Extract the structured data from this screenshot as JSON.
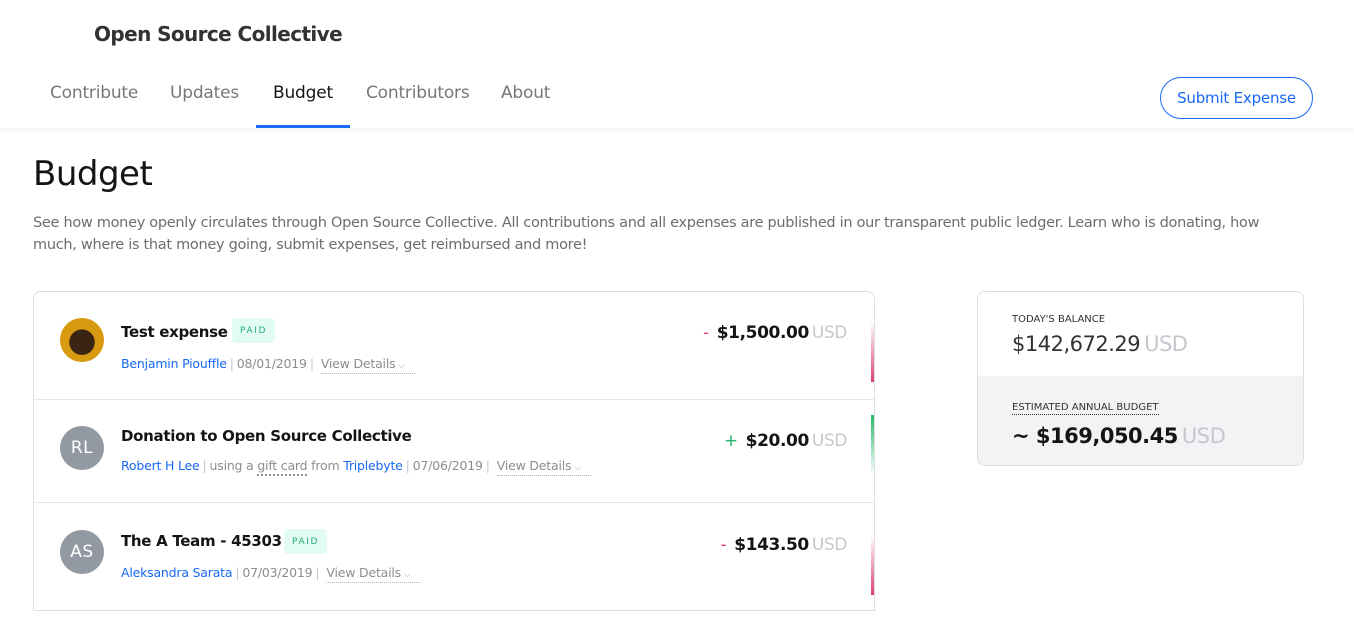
{
  "header": {
    "collective_name": "Open Source Collective",
    "tabs": [
      {
        "label": "Contribute"
      },
      {
        "label": "Updates"
      },
      {
        "label": "Budget"
      },
      {
        "label": "Contributors"
      },
      {
        "label": "About"
      }
    ],
    "active_tab": "Budget",
    "submit_button": "Submit Expense"
  },
  "page": {
    "title": "Budget",
    "description": "See how money openly circulates through Open Source Collective. All contributions and all expenses are published in our transparent public ledger. Learn who is donating, how much, where is that money going, submit expenses, get reimbursed and more!"
  },
  "transactions": [
    {
      "title": "Test expense",
      "badge": "PAID",
      "author": "Benjamin Piouffle",
      "date": "08/01/2019",
      "details_label": "View Details",
      "sign": "-",
      "amount": "$1,500.00",
      "currency": "USD"
    },
    {
      "title": "Donation to Open Source Collective",
      "avatar_initials": "RL",
      "author": "Robert H Lee",
      "via_text": "using a",
      "method": "gift card",
      "from_text": "from",
      "source": "Triplebyte",
      "date": "07/06/2019",
      "details_label": "View Details",
      "sign": "+",
      "amount": "$20.00",
      "currency": "USD"
    },
    {
      "title": "The A Team - 45303",
      "badge": "PAID",
      "avatar_initials": "AS",
      "author": "Aleksandra Sarata",
      "date": "07/03/2019",
      "details_label": "View Details",
      "sign": "-",
      "amount": "$143.50",
      "currency": "USD"
    }
  ],
  "balance": {
    "todays_label": "TODAY'S BALANCE",
    "todays_amount": "$142,672.29",
    "todays_currency": "USD",
    "estimated_label": "ESTIMATED ANNUAL BUDGET",
    "estimated_amount": "~ $169,050.45",
    "estimated_currency": "USD"
  },
  "colors": {
    "accent": "#1869f5",
    "expense": "#e03f6c",
    "income": "#25b869",
    "paid_badge_bg": "#e3fcf3",
    "paid_badge_text": "#23ad73"
  }
}
